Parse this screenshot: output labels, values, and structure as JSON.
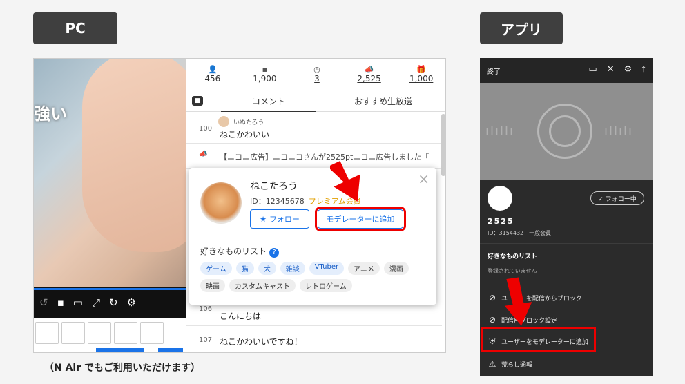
{
  "labels": {
    "pc": "PC",
    "app": "アプリ",
    "footnote": "（N Air でもご利用いただけます）"
  },
  "video": {
    "overlay_text": "強い"
  },
  "stats": [
    {
      "icon": "user-icon",
      "glyph": "👤",
      "value": "456",
      "underline": false
    },
    {
      "icon": "comment-icon",
      "glyph": "▪",
      "value": "1,900",
      "underline": false
    },
    {
      "icon": "clock-icon",
      "glyph": "◷",
      "value": "3",
      "underline": true
    },
    {
      "icon": "ad-icon",
      "glyph": "📣",
      "value": "2,525",
      "underline": true
    },
    {
      "icon": "gift-icon",
      "glyph": "🎁",
      "value": "1,000",
      "underline": true
    }
  ],
  "tabs": {
    "comment": "コメント",
    "recommend": "おすすめ生放送"
  },
  "comments": [
    {
      "num": "100",
      "user": "いぬたろう",
      "text": "ねこかわいい"
    },
    {
      "num": "",
      "user": "",
      "text": "【ニコニ広告】ニコニコさんが2525ptニコニ広告しました「"
    },
    {
      "num": "106",
      "user": "",
      "text": "こんにちは"
    },
    {
      "num": "107",
      "user": "",
      "text": "ねこかわいいですね！"
    }
  ],
  "popup": {
    "name": "ねこたろう",
    "id_label": "ID：12345678",
    "premium": "プレミアム会員",
    "follow": "フォロー",
    "add_moderator": "モデレーターに追加",
    "close": "×",
    "likes_title": "好きなものリスト",
    "tags": [
      {
        "label": "ゲーム",
        "blue": true
      },
      {
        "label": "猫",
        "blue": true
      },
      {
        "label": "犬",
        "blue": true
      },
      {
        "label": "雑談",
        "blue": true
      },
      {
        "label": "VTuber",
        "blue": true
      },
      {
        "label": "アニメ",
        "blue": false
      },
      {
        "label": "漫画",
        "blue": false
      },
      {
        "label": "映画",
        "blue": false
      },
      {
        "label": "カスタムキャスト",
        "blue": false
      },
      {
        "label": "レトロゲーム",
        "blue": false
      }
    ]
  },
  "app": {
    "end": "終了",
    "follow": "✓ フォロー中",
    "name": "2525",
    "id": "ID：3154432　一般会員",
    "likes_title": "好きなものリスト",
    "likes_empty": "登録されていません",
    "items": [
      {
        "icon": "block-user-icon",
        "label": "ユーザーを配信からブロック"
      },
      {
        "icon": "block-settings-icon",
        "label": "配信用ブロック設定"
      },
      {
        "icon": "shield-user-icon",
        "label": "ユーザーをモデレーターに追加"
      },
      {
        "icon": "report-icon",
        "label": "荒らし通報"
      }
    ]
  },
  "colors": {
    "accent": "#1a73e8",
    "highlight": "#e00000",
    "premium": "#e2a000"
  }
}
